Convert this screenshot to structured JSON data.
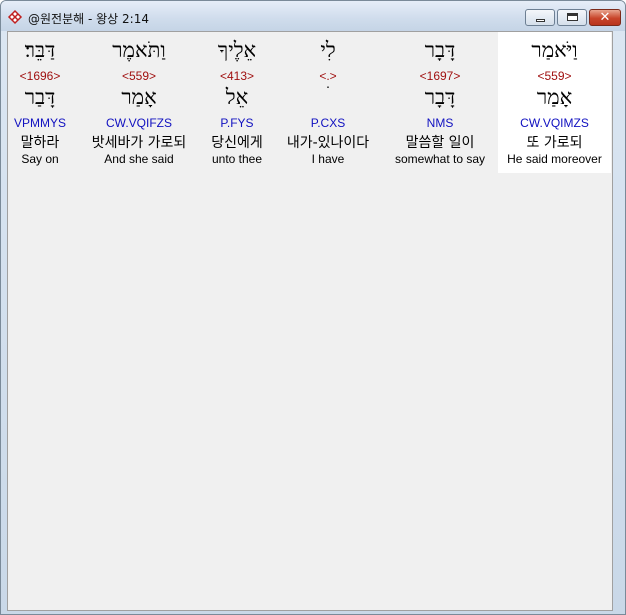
{
  "window": {
    "title": "@원전분해 - 왕상 2:14",
    "icon": "app-cross-icon",
    "min_label": "",
    "max_label": "",
    "close_label": "✕"
  },
  "colors": {
    "strong": "#a01010",
    "morph": "#1010c0",
    "selected_bg": "#ffffff",
    "panel_bg": "#f0f0f0"
  },
  "words": [
    {
      "hebrew": "דַּבֵּר׃",
      "strong": "<1696>",
      "root": "דָּבַר",
      "morph": "VPMMYS",
      "korean": "말하라",
      "english": "Say on"
    },
    {
      "hebrew": "וַתֹּאמֶר",
      "strong": "<559>",
      "root": "אָמַר",
      "morph": "CW.VQIFZS",
      "korean": "밧세바가 가로되",
      "english": "And she said"
    },
    {
      "hebrew": "אֵלֶיךָ",
      "strong": "<413>",
      "root": "אֵל",
      "morph": "P.FYS",
      "korean": "당신에게",
      "english": "unto thee"
    },
    {
      "hebrew": "לִי",
      "strong": "<.>",
      "root": "ׄ",
      "morph": "P.CXS",
      "korean": "내가-있나이다",
      "english": "I have"
    },
    {
      "hebrew": "דָּבָר",
      "strong": "<1697>",
      "root": "דָּבָר",
      "morph": "NMS",
      "korean": "말씀할 일이",
      "english": "somewhat to say"
    },
    {
      "hebrew": "וַיֹּאמַר",
      "strong": "<559>",
      "root": "אָמַר",
      "morph": "CW.VQIMZS",
      "korean": "또 가로되",
      "english": "He said moreover"
    }
  ]
}
